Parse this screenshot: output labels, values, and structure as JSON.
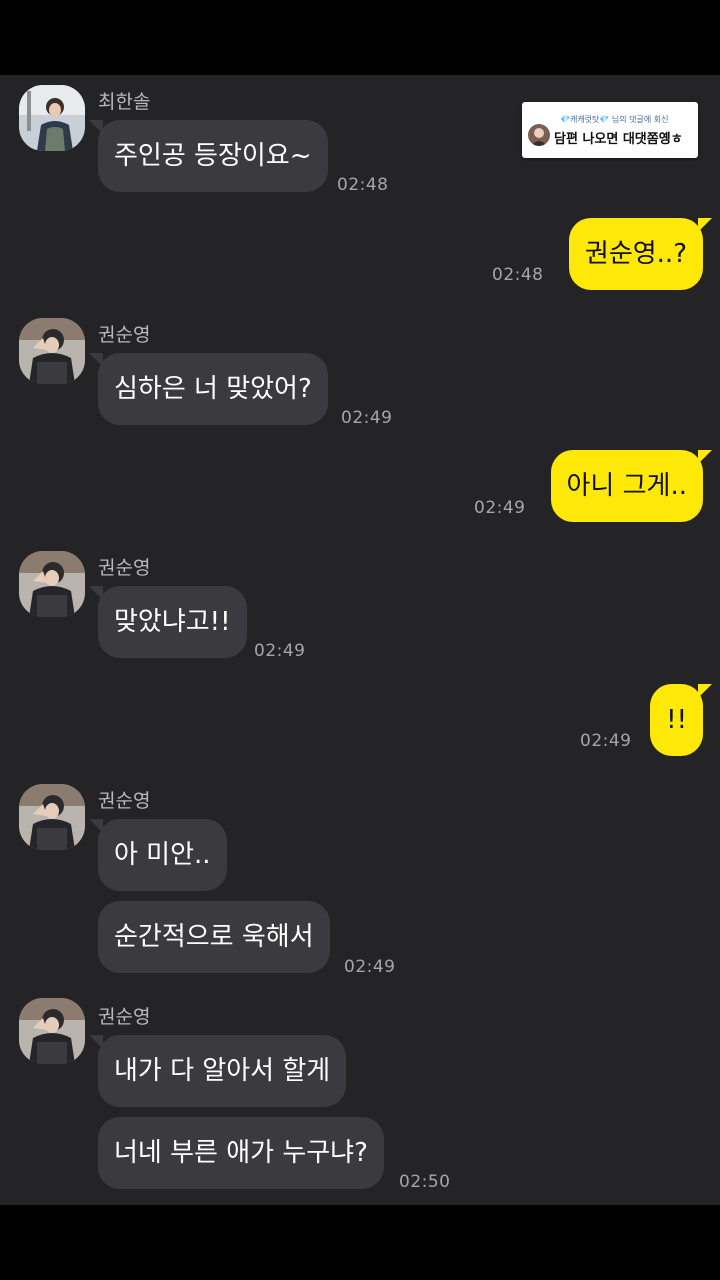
{
  "comment_badge": {
    "reply_to": "💎캐캐럿탓💎 님의 댓글에 회신",
    "text": "담편 나오면 대댓쫌옝ㅎ"
  },
  "messages": [
    {
      "sender": "최한솔",
      "text": "주인공 등장이요~",
      "time": "02:48"
    },
    {
      "sender": "me",
      "text": "권순영..?",
      "time": "02:48"
    },
    {
      "sender": "권순영",
      "text": "심하은 너 맞았어?",
      "time": "02:49"
    },
    {
      "sender": "me",
      "text": "아니 그게..",
      "time": "02:49"
    },
    {
      "sender": "권순영",
      "text": "맞았냐고!!",
      "time": "02:49"
    },
    {
      "sender": "me",
      "text": "!!",
      "time": "02:49"
    },
    {
      "sender": "권순영",
      "text": "아 미안..",
      "time": ""
    },
    {
      "sender": "권순영",
      "text": "순간적으로 욱해서",
      "time": "02:49"
    },
    {
      "sender": "권순영",
      "text": "내가 다 알아서 할게",
      "time": ""
    },
    {
      "sender": "권순영",
      "text": "너네 부른 애가 누구냐?",
      "time": "02:50"
    }
  ],
  "colors": {
    "background": "#242426",
    "incoming_bubble": "#3b3b3f",
    "outgoing_bubble": "#fde807",
    "letterbox": "#000000"
  },
  "icons": [
    "profile-avatar-icon"
  ]
}
